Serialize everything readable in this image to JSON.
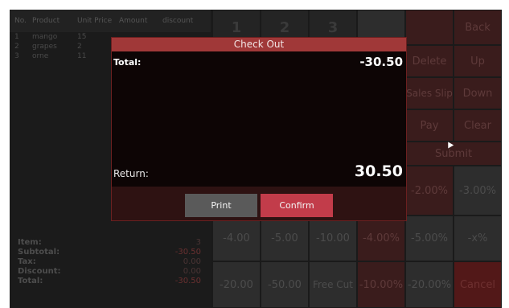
{
  "order": {
    "headers": [
      "No.",
      "Product",
      "Unit Price",
      "Amount",
      "discount"
    ],
    "rows": [
      {
        "no": "1",
        "product": "mango",
        "price": "15"
      },
      {
        "no": "2",
        "product": "grapes",
        "price": "2"
      },
      {
        "no": "3",
        "product": "orne",
        "price": "11"
      }
    ]
  },
  "totals": {
    "item_label": "Item:",
    "item_value": "3",
    "subtotal_label": "Subtotal:",
    "subtotal_value": "-30.50",
    "tax_label": "Tax:",
    "tax_value": "0.00",
    "discount_label": "Discount:",
    "discount_value": "0.00",
    "total_label": "Total:",
    "total_value": "-30.50"
  },
  "keypad": {
    "num1": "1",
    "num2": "2",
    "num3": "3",
    "back": "Back",
    "delete": "Delete",
    "up": "Up",
    "sales_slip": "Sales Slip",
    "down": "Down",
    "pay": "Pay",
    "clear": "Clear",
    "submit": "Submit",
    "d_2pct": "-2.00%",
    "d_3pct": "-3.00%",
    "d_4": "-4.00",
    "d_5": "-5.00",
    "d_10": "-10.00",
    "d_4pct": "-4.00%",
    "d_5pct": "-5.00%",
    "d_xpct": "-x%",
    "d_20": "-20.00",
    "d_50": "-50.00",
    "free_cut": "Free Cut",
    "d_10pct": "-10.00%",
    "d_20pct": "-20.00%",
    "cancel": "Cancel"
  },
  "dialog": {
    "title": "Check Out",
    "total_label": "Total:",
    "total_value": "-30.50",
    "return_label": "Return:",
    "return_value": "30.50",
    "print_label": "Print",
    "confirm_label": "Confirm"
  },
  "colors": {
    "dialog_title_bg": "#a03838",
    "confirm_bg": "#c23c4a",
    "print_bg": "#5a5a5a"
  }
}
